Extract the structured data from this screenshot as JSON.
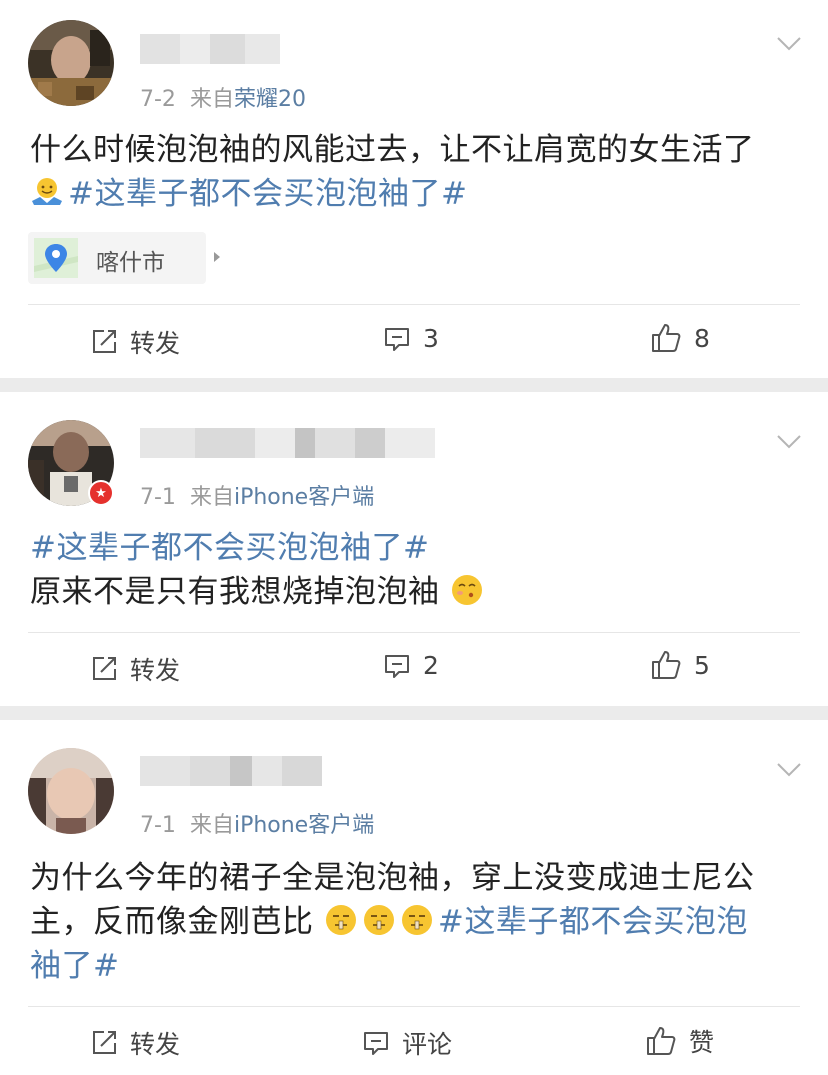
{
  "posts": [
    {
      "date": "7-2",
      "from_label": "来自",
      "source": "荣耀20",
      "text_plain": "什么时候泡泡袖的风能过去，让不让肩宽的女生活了",
      "topic": "#这辈子都不会买泡泡袖了#",
      "location": "喀什市",
      "repost_label": "转发",
      "comment_count": "3",
      "like_count": "8"
    },
    {
      "date": "7-1",
      "from_label": "来自",
      "source": "iPhone客户端",
      "topic": "#这辈子都不会买泡泡袖了#",
      "text_plain": "原来不是只有我想烧掉泡泡袖",
      "repost_label": "转发",
      "comment_count": "2",
      "like_count": "5"
    },
    {
      "date": "7-1",
      "from_label": "来自",
      "source": "iPhone客户端",
      "text_line1": "为什么今年的裙子全是泡泡袖，穿上没变成迪士尼公",
      "text_line2": "主，反而像金刚芭比",
      "topic_part1": "#这辈子都不会买泡泡",
      "topic_part2": "袖了#",
      "repost_label": "转发",
      "comment_label": "评论",
      "like_label": "赞"
    }
  ],
  "icons": {
    "repost": "repost-icon",
    "comment": "comment-icon",
    "like": "thumbs-up-icon",
    "more": "chevron-down-icon",
    "location": "location-pin-icon",
    "emoji1": "shrug-emoji-icon",
    "emoji2": "kiss-emoji-icon",
    "emoji3": "shh-emoji-icon"
  },
  "colors": {
    "topic": "#507daf",
    "source": "#5b7ea3",
    "meta": "#9a9a9a",
    "separator": "#ebebeb",
    "verified_badge": "#e5312d"
  }
}
